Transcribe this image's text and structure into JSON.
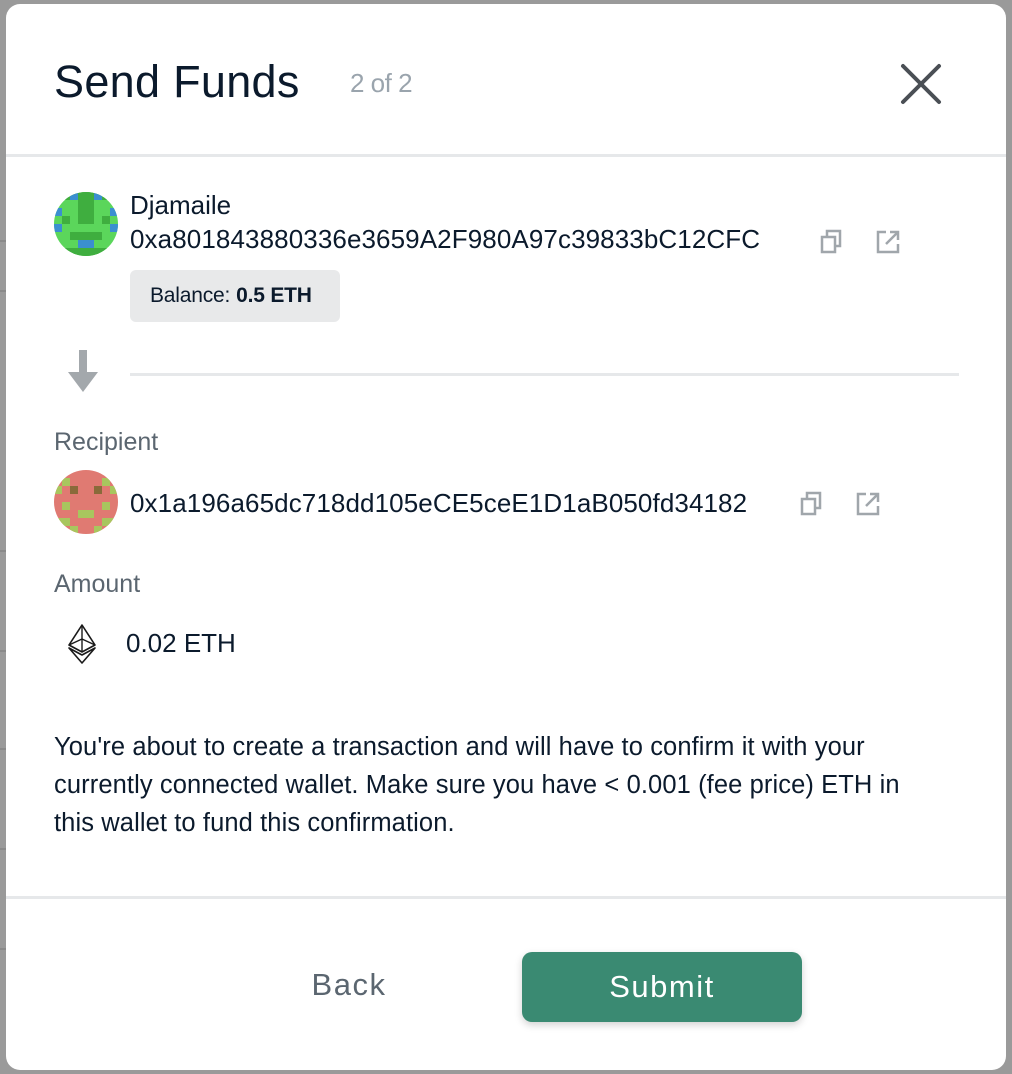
{
  "modal": {
    "title": "Send Funds",
    "step": "2 of 2"
  },
  "sender": {
    "name": "Djamaile",
    "address": "0xa801843880336e3659A2F980A97c39833bC12CFC",
    "balance_label": "Balance:",
    "balance_value": "0.5 ETH"
  },
  "recipient": {
    "label": "Recipient",
    "address": "0x1a196a65dc718dd105eCE5ceE1D1aB050fd34182"
  },
  "amount": {
    "label": "Amount",
    "value": "0.02 ETH"
  },
  "notice": "You're about to create a transaction and will have to confirm it with your currently connected wallet. Make sure you have < 0.001 (fee price) ETH in this wallet to fund this confirmation.",
  "footer": {
    "back_label": "Back",
    "submit_label": "Submit"
  },
  "colors": {
    "accent": "#3a8a72",
    "text": "#0b1a2c",
    "muted": "#5b6670"
  },
  "icons": {
    "close": "close-icon",
    "copy": "copy-icon",
    "external": "external-link-icon",
    "arrow": "arrow-down-icon",
    "eth": "ethereum-icon"
  }
}
